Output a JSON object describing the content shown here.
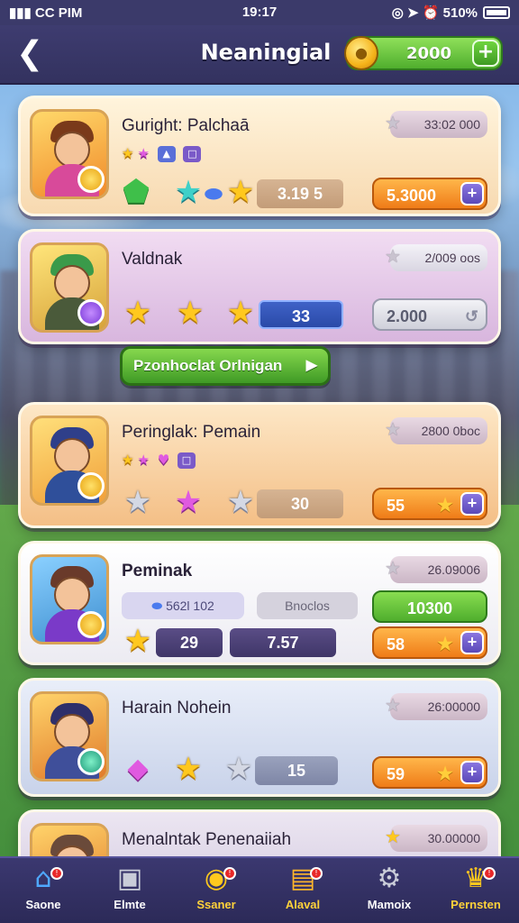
{
  "status_bar": {
    "left": "▮▮▮ CC PIM",
    "time": "19:17",
    "right": "◎ ➤ ⏰ 510%"
  },
  "header": {
    "back_icon": "chevron-left-icon",
    "title": "Neaningial",
    "coin_amount": "2000",
    "add_label": "+"
  },
  "cards": [
    {
      "name": "Guright: Palchaā",
      "score": "33:02 000",
      "value": "3.19 5",
      "action_label": "5.3000",
      "mini_label": "□"
    },
    {
      "name": "Valdnak",
      "score": "2/009 oos",
      "value": "33",
      "action_label": "2.000"
    },
    {
      "name": "Peringlak: Pemain",
      "score": "2800 0boc",
      "value": "30",
      "action_label": "55"
    },
    {
      "name": "Peminak",
      "score": "26.09006",
      "chip1": "562l 102",
      "chip2": "Bnoclos",
      "green_label": "10300",
      "value1": "29",
      "value2": "7.57",
      "action_label": "58"
    },
    {
      "name": "Harain Nohein",
      "score": "26:00000",
      "value": "15",
      "action_label": "59"
    },
    {
      "name": "Menalntak Penenaiiah",
      "score": "30.00000"
    }
  ],
  "promo_button": "Pzonhoclat Orlnigan",
  "bottom_nav": [
    {
      "label": "Saone",
      "icon": "house-icon",
      "badge": "!"
    },
    {
      "label": "Elmte",
      "icon": "box-icon",
      "badge": ""
    },
    {
      "label": "Ssaner",
      "icon": "coins-icon",
      "badge": "!",
      "active": true
    },
    {
      "label": "Alaval",
      "icon": "chest-icon",
      "badge": "!"
    },
    {
      "label": "Mamoix",
      "icon": "gear-icon",
      "badge": ""
    },
    {
      "label": "Pernsten",
      "icon": "trophy-icon",
      "badge": "!",
      "active": true
    }
  ]
}
